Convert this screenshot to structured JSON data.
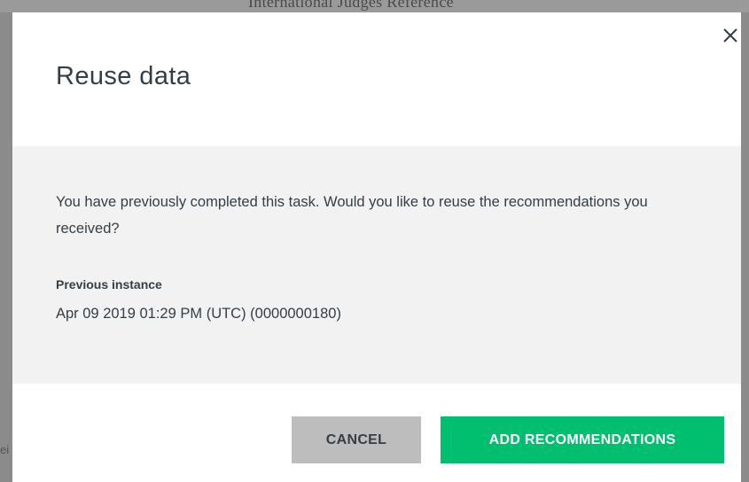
{
  "background": {
    "partial_text": "International Judges Reference",
    "left_glyph": "ei"
  },
  "dialog": {
    "title": "Reuse data",
    "close_icon": "close-icon",
    "message": "You have previously completed this task. Would you like to reuse the recommendations you received?",
    "previous_instance": {
      "label": "Previous instance",
      "value": "Apr 09 2019 01:29 PM (UTC) (0000000180)"
    },
    "buttons": {
      "cancel_label": "CANCEL",
      "add_label": "ADD RECOMMENDATIONS"
    }
  },
  "colors": {
    "primary": "#00bf6f",
    "cancel": "#bdbdbd",
    "text": "#333e48",
    "body_bg": "#f2f2f2"
  }
}
